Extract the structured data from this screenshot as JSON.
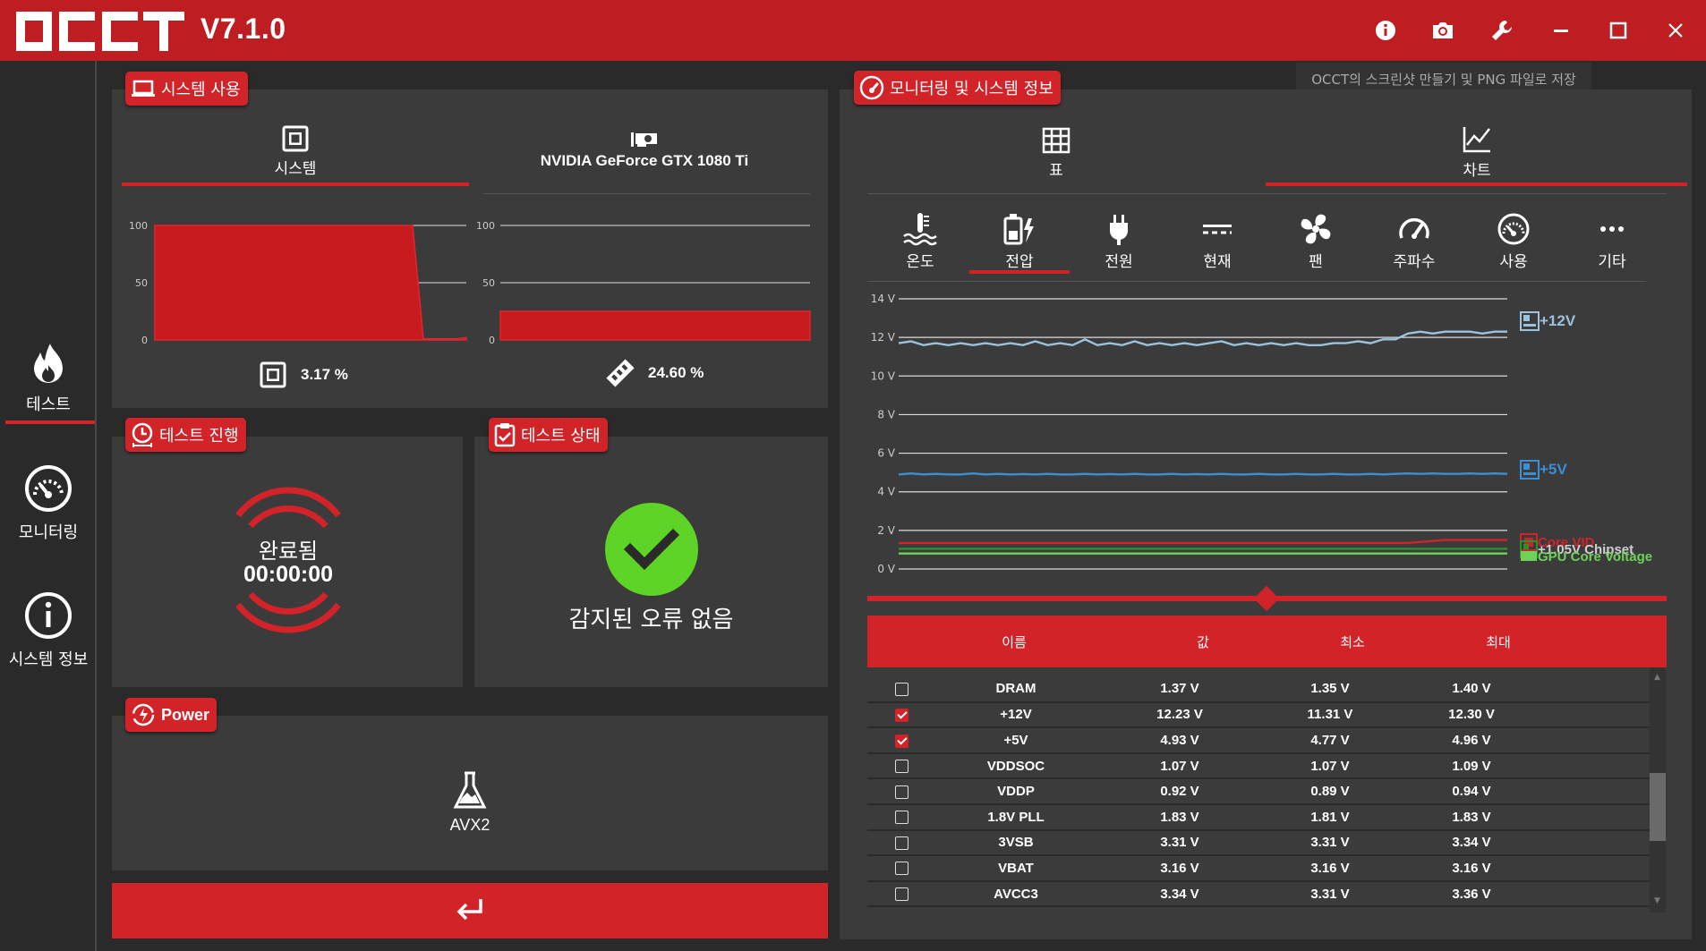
{
  "app": {
    "logo_text": "OCCT",
    "version": "V7.1.0",
    "tooltip": "OCCT의 스크린샷 만들기 및 PNG 파일로 저장"
  },
  "titlebar_icons": [
    "info-icon",
    "camera-icon",
    "wrench-icon",
    "minimize-icon",
    "maximize-icon",
    "close-icon"
  ],
  "sidebar": {
    "items": [
      {
        "label": "테스트",
        "icon": "flame-icon",
        "active": true
      },
      {
        "label": "모니터링",
        "icon": "gauge-icon",
        "active": false
      },
      {
        "label": "시스템 정보",
        "icon": "info-circle-icon",
        "active": false
      }
    ]
  },
  "usage": {
    "tag": "시스템 사용",
    "tabs": [
      {
        "label": "시스템",
        "icon": "cpu-icon",
        "active": true
      },
      {
        "label": "NVIDIA GeForce GTX 1080 Ti",
        "icon": "gpu-icon",
        "active": false
      }
    ],
    "axis": [
      "100",
      "50",
      "0"
    ],
    "cpu_value": "3.17 %",
    "gpu_value": "24.60 %",
    "cpu_fraction": 0.0317,
    "gpu_fraction": 0.246
  },
  "progress": {
    "tag": "테스트 진행",
    "status": "완료됨",
    "time": "00:00:00"
  },
  "status": {
    "tag": "테스트 상태",
    "message": "감지된 오류 없음"
  },
  "power": {
    "tag": "Power",
    "mode": "AVX2"
  },
  "monitor": {
    "tag": "모니터링 및 시스템 정보",
    "view_tabs": [
      {
        "label": "표",
        "icon": "table-icon",
        "active": false
      },
      {
        "label": "차트",
        "icon": "chart-icon",
        "active": true
      }
    ],
    "sub_tabs": [
      {
        "label": "온도",
        "icon": "thermometer-icon",
        "active": false
      },
      {
        "label": "전압",
        "icon": "battery-bolt-icon",
        "active": true
      },
      {
        "label": "전원",
        "icon": "plug-icon",
        "active": false
      },
      {
        "label": "현재",
        "icon": "dc-current-icon",
        "active": false
      },
      {
        "label": "팬",
        "icon": "fan-icon",
        "active": false
      },
      {
        "label": "주파수",
        "icon": "speedometer-icon",
        "active": false
      },
      {
        "label": "사용",
        "icon": "usage-gauge-icon",
        "active": false
      },
      {
        "label": "기타",
        "icon": "more-icon",
        "active": false
      }
    ],
    "columns": [
      "이름",
      "값",
      "최소",
      "최대"
    ],
    "rows": [
      {
        "checked": false,
        "name": "DRAM",
        "value": "1.37 V",
        "min": "1.35 V",
        "max": "1.40 V"
      },
      {
        "checked": true,
        "name": "+12V",
        "value": "12.23 V",
        "min": "11.31 V",
        "max": "12.30 V"
      },
      {
        "checked": true,
        "name": "+5V",
        "value": "4.93 V",
        "min": "4.77 V",
        "max": "4.96 V"
      },
      {
        "checked": false,
        "name": "VDDSOC",
        "value": "1.07 V",
        "min": "1.07 V",
        "max": "1.09 V"
      },
      {
        "checked": false,
        "name": "VDDP",
        "value": "0.92 V",
        "min": "0.89 V",
        "max": "0.94 V"
      },
      {
        "checked": false,
        "name": "1.8V PLL",
        "value": "1.83 V",
        "min": "1.81 V",
        "max": "1.83 V"
      },
      {
        "checked": false,
        "name": "3VSB",
        "value": "3.31 V",
        "min": "3.31 V",
        "max": "3.34 V"
      },
      {
        "checked": false,
        "name": "VBAT",
        "value": "3.16 V",
        "min": "3.16 V",
        "max": "3.16 V"
      },
      {
        "checked": false,
        "name": "AVCC3",
        "value": "3.34 V",
        "min": "3.31 V",
        "max": "3.36 V"
      }
    ]
  },
  "chart_data": [
    {
      "type": "area",
      "title": "",
      "ylim": [
        0,
        100
      ],
      "yticks": [
        "100",
        "50",
        "0"
      ],
      "series": [
        {
          "values": [
            100,
            100,
            100,
            100,
            100,
            100,
            100,
            100,
            100,
            100,
            100,
            100,
            100,
            100,
            100,
            100,
            100,
            100,
            100,
            100,
            100,
            100,
            100,
            100,
            100,
            1,
            1,
            1,
            1,
            2
          ]
        }
      ]
    },
    {
      "type": "area",
      "title": "",
      "ylim": [
        0,
        100
      ],
      "yticks": [
        "100",
        "50",
        "0"
      ],
      "series": [
        {
          "values": [
            25,
            25,
            25,
            25,
            25,
            25,
            25,
            25,
            25,
            25,
            25,
            25,
            25,
            25,
            25,
            25,
            25,
            25,
            25,
            25,
            25,
            25,
            25,
            25,
            25,
            25,
            25,
            25,
            25,
            25
          ]
        }
      ]
    },
    {
      "type": "line",
      "ylabel": "",
      "ylim": [
        0,
        14
      ],
      "yticks": [
        "14 V",
        "12 V",
        "10 V",
        "8 V",
        "6 V",
        "4 V",
        "2 V",
        "0 V"
      ],
      "legend": [
        "+12V",
        "+5V",
        "Core VID",
        "+1.05V Chipset",
        "GPU Core Voltage"
      ],
      "series": [
        {
          "name": "+12V",
          "color": "#9cc3dc",
          "values": [
            11.7,
            11.8,
            11.6,
            11.7,
            11.6,
            11.7,
            11.6,
            11.7,
            11.6,
            11.7,
            11.6,
            11.8,
            11.6,
            11.7,
            11.6,
            11.9,
            11.6,
            11.7,
            11.6,
            11.8,
            11.6,
            11.7,
            11.6,
            11.7,
            11.6,
            11.7,
            11.8,
            11.6,
            11.7,
            11.6,
            11.7,
            11.6,
            11.7,
            11.6,
            11.6,
            11.7,
            11.7,
            11.8,
            11.7,
            11.9,
            11.9,
            12.2,
            12.3,
            12.2,
            12.3,
            12.3,
            12.3,
            12.2,
            12.3,
            12.3
          ]
        },
        {
          "name": "+5V",
          "color": "#3b8fd4",
          "values": [
            4.9,
            4.95,
            4.9,
            4.93,
            4.9,
            4.9,
            4.95,
            4.9,
            4.93,
            4.9,
            4.92,
            4.9,
            4.93,
            4.9,
            4.9,
            4.93,
            4.9,
            4.92,
            4.9,
            4.93,
            4.9,
            4.9,
            4.93,
            4.9,
            4.92,
            4.9,
            4.93,
            4.9,
            4.9,
            4.93,
            4.9,
            4.9,
            4.93,
            4.9,
            4.9,
            4.93,
            4.9,
            4.9,
            4.93,
            4.9,
            4.93,
            4.95,
            4.93,
            4.95,
            4.93,
            4.93,
            4.95,
            4.93,
            4.95,
            4.93
          ]
        },
        {
          "name": "Core VID",
          "color": "#d22329",
          "values": [
            1.35,
            1.35,
            1.35,
            1.35,
            1.35,
            1.35,
            1.35,
            1.35,
            1.35,
            1.35,
            1.35,
            1.35,
            1.35,
            1.35,
            1.35,
            1.35,
            1.35,
            1.35,
            1.35,
            1.35,
            1.35,
            1.35,
            1.35,
            1.35,
            1.35,
            1.35,
            1.35,
            1.35,
            1.35,
            1.35,
            1.35,
            1.35,
            1.35,
            1.35,
            1.35,
            1.35,
            1.35,
            1.35,
            1.35,
            1.35,
            1.35,
            1.35,
            1.4,
            1.45,
            1.5,
            1.5,
            1.5,
            1.5,
            1.5,
            1.5
          ]
        },
        {
          "name": "+1.05V Chipset",
          "color": "#2f8f2f",
          "values": [
            1.05,
            1.05,
            1.05,
            1.05,
            1.05,
            1.05,
            1.05,
            1.05,
            1.05,
            1.05,
            1.05,
            1.05,
            1.05,
            1.05,
            1.05,
            1.05,
            1.05,
            1.05,
            1.05,
            1.05,
            1.05,
            1.05,
            1.05,
            1.05,
            1.05,
            1.05,
            1.05,
            1.05,
            1.05,
            1.05,
            1.05,
            1.05,
            1.05,
            1.05,
            1.05,
            1.05,
            1.05,
            1.05,
            1.05,
            1.05,
            1.05,
            1.05,
            1.05,
            1.05,
            1.05,
            1.05,
            1.05,
            1.05,
            1.05,
            1.05
          ]
        },
        {
          "name": "GPU Core Voltage",
          "color": "#6fd15a",
          "values": [
            0.8,
            0.8,
            0.8,
            0.8,
            0.8,
            0.8,
            0.8,
            0.8,
            0.8,
            0.8,
            0.8,
            0.8,
            0.8,
            0.8,
            0.8,
            0.8,
            0.8,
            0.8,
            0.8,
            0.8,
            0.8,
            0.8,
            0.8,
            0.8,
            0.8,
            0.8,
            0.8,
            0.8,
            0.8,
            0.8,
            0.8,
            0.8,
            0.8,
            0.8,
            0.8,
            0.8,
            0.8,
            0.8,
            0.8,
            0.8,
            0.8,
            0.8,
            0.8,
            0.8,
            0.8,
            0.8,
            0.8,
            0.8,
            0.8,
            0.8
          ]
        }
      ]
    }
  ]
}
